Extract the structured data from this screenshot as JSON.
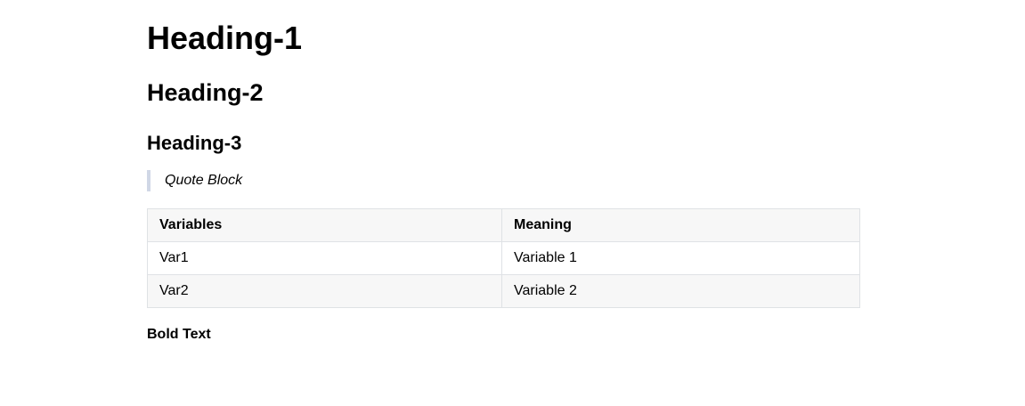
{
  "document": {
    "heading_1": "Heading-1",
    "heading_2": "Heading-2",
    "heading_3": "Heading-3",
    "quote": "Quote Block",
    "table": {
      "headers": [
        "Variables",
        "Meaning"
      ],
      "rows": [
        [
          "Var1",
          "Variable 1"
        ],
        [
          "Var2",
          "Variable 2"
        ]
      ]
    },
    "bold_text": "Bold Text"
  },
  "colors": {
    "quote_border": "#d0d7e6",
    "table_border": "#dfe2e5",
    "table_header_bg": "#f7f7f7",
    "table_alt_row_bg": "#f7f7f7"
  }
}
